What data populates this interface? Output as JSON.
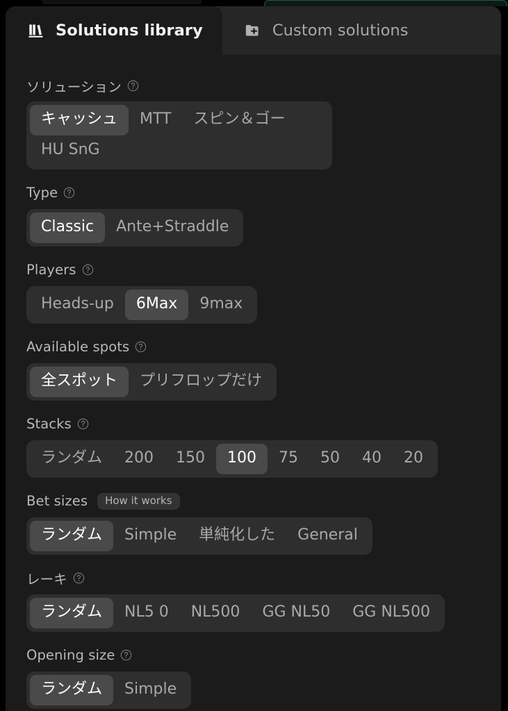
{
  "window": {
    "background_color": "#000000",
    "panel_color": "#262626",
    "content_color": "#1b1b1b",
    "accent_color": "#1f5c4d",
    "selected_pill_color": "#4a4a4a",
    "group_color": "#2e2e2e"
  },
  "tabs": [
    {
      "id": "solutions-library",
      "label": "Solutions library",
      "icon": "library-books-icon",
      "active": true
    },
    {
      "id": "custom-solutions",
      "label": "Custom solutions",
      "icon": "folder-plus-icon",
      "active": false
    }
  ],
  "fields": [
    {
      "id": "solution",
      "label": "ソリューション",
      "help": "help-icon",
      "wrap": true,
      "options": [
        {
          "label": "キャッシュ",
          "selected": true
        },
        {
          "label": "MTT",
          "selected": false
        },
        {
          "label": "スピン＆ゴー",
          "selected": false
        },
        {
          "label": "HU SnG",
          "selected": false
        }
      ]
    },
    {
      "id": "type",
      "label": "Type",
      "help": "help-icon",
      "wrap": false,
      "options": [
        {
          "label": "Classic",
          "selected": true
        },
        {
          "label": "Ante+Straddle",
          "selected": false
        }
      ]
    },
    {
      "id": "players",
      "label": "Players",
      "help": "help-icon",
      "wrap": false,
      "options": [
        {
          "label": "Heads-up",
          "selected": false
        },
        {
          "label": "6Max",
          "selected": true
        },
        {
          "label": "9max",
          "selected": false
        }
      ]
    },
    {
      "id": "available-spots",
      "label": "Available spots",
      "help": "help-icon",
      "wrap": false,
      "options": [
        {
          "label": "全スポット",
          "selected": true
        },
        {
          "label": "プリフロップだけ",
          "selected": false
        }
      ]
    },
    {
      "id": "stacks",
      "label": "Stacks",
      "help": "help-icon",
      "wrap": false,
      "options": [
        {
          "label": "ランダム",
          "selected": false
        },
        {
          "label": "200",
          "selected": false
        },
        {
          "label": "150",
          "selected": false
        },
        {
          "label": "100",
          "selected": true
        },
        {
          "label": "75",
          "selected": false
        },
        {
          "label": "50",
          "selected": false
        },
        {
          "label": "40",
          "selected": false
        },
        {
          "label": "20",
          "selected": false
        }
      ]
    },
    {
      "id": "bet-sizes",
      "label": "Bet sizes",
      "badge": "How it works",
      "wrap": false,
      "options": [
        {
          "label": "ランダム",
          "selected": true
        },
        {
          "label": "Simple",
          "selected": false
        },
        {
          "label": "単純化した",
          "selected": false
        },
        {
          "label": "General",
          "selected": false
        }
      ]
    },
    {
      "id": "rake",
      "label": "レーキ",
      "help": "help-icon",
      "wrap": false,
      "options": [
        {
          "label": "ランダム",
          "selected": true
        },
        {
          "label": "NL5 0",
          "selected": false
        },
        {
          "label": "NL500",
          "selected": false
        },
        {
          "label": "GG NL50",
          "selected": false
        },
        {
          "label": "GG NL500",
          "selected": false
        }
      ]
    },
    {
      "id": "opening-size",
      "label": "Opening size",
      "help": "help-icon",
      "wrap": false,
      "options": [
        {
          "label": "ランダム",
          "selected": true
        },
        {
          "label": "Simple",
          "selected": false
        }
      ]
    }
  ]
}
